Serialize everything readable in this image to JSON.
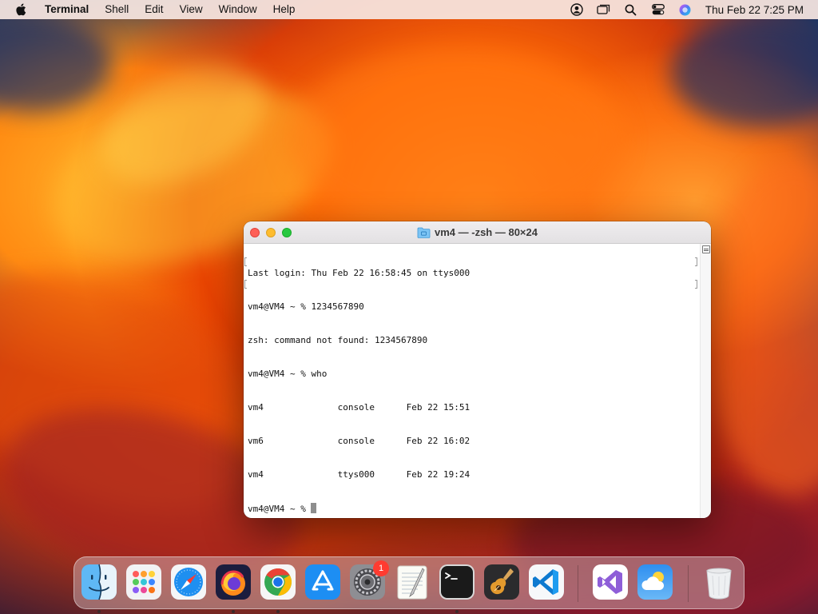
{
  "menubar": {
    "app_name": "Terminal",
    "menus": [
      "Shell",
      "Edit",
      "View",
      "Window",
      "Help"
    ],
    "clock": "Thu Feb 22  7:25 PM",
    "status_icons": [
      "user-account-icon",
      "screen-mirroring-icon",
      "spotlight-search-icon",
      "control-center-icon",
      "siri-icon"
    ]
  },
  "terminal": {
    "title": "vm4 — -zsh — 80×24",
    "lines": [
      "Last login: Thu Feb 22 16:58:45 on ttys000",
      "vm4@VM4 ~ % 1234567890",
      "zsh: command not found: 1234567890",
      "vm4@VM4 ~ % who",
      "vm4              console      Feb 22 15:51",
      "vm6              console      Feb 22 16:02",
      "vm4              ttys000      Feb 22 19:24",
      "vm4@VM4 ~ % "
    ]
  },
  "dock": {
    "apps": [
      {
        "name": "Finder",
        "icon": "finder-icon",
        "running": true
      },
      {
        "name": "Launchpad",
        "icon": "launchpad-icon",
        "running": false
      },
      {
        "name": "Safari",
        "icon": "safari-icon",
        "running": false
      },
      {
        "name": "Firefox",
        "icon": "firefox-icon",
        "running": true
      },
      {
        "name": "Google Chrome",
        "icon": "chrome-icon",
        "running": true
      },
      {
        "name": "App Store",
        "icon": "app-store-icon",
        "running": false
      },
      {
        "name": "System Settings",
        "icon": "system-settings-icon",
        "running": false,
        "badge": "1"
      },
      {
        "name": "TextEdit",
        "icon": "textedit-icon",
        "running": false
      },
      {
        "name": "Terminal",
        "icon": "terminal-icon",
        "running": true
      },
      {
        "name": "GarageBand",
        "icon": "garageband-icon",
        "running": false
      },
      {
        "name": "Visual Studio Code",
        "icon": "vscode-icon",
        "running": false
      },
      {
        "name": "Visual Studio",
        "icon": "visual-studio-icon",
        "running": false
      },
      {
        "name": "Weather",
        "icon": "weather-icon",
        "running": false
      },
      {
        "name": "Trash",
        "icon": "trash-icon",
        "running": false
      }
    ]
  }
}
